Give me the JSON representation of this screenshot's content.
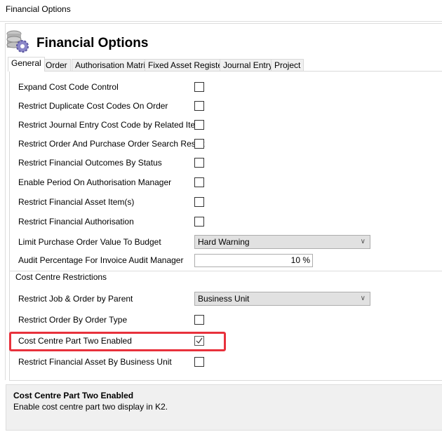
{
  "window": {
    "title": "Financial Options"
  },
  "header": {
    "title": "Financial Options",
    "icon": "coins-gear-icon"
  },
  "tabs": [
    {
      "label": "General",
      "active": true
    },
    {
      "label": "Order"
    },
    {
      "label": "Authorisation Matrix"
    },
    {
      "label": "Fixed Asset Register"
    },
    {
      "label": "Journal Entry"
    },
    {
      "label": "Project"
    }
  ],
  "general": {
    "options": [
      {
        "label": "Expand Cost Code Control",
        "checked": false
      },
      {
        "label": "Restrict Duplicate Cost Codes On Order",
        "checked": false
      },
      {
        "label": "Restrict Journal Entry Cost Code by Related Item",
        "checked": false
      },
      {
        "label": "Restrict Order And Purchase Order Search Result",
        "checked": false
      },
      {
        "label": "Restrict Financial Outcomes By Status",
        "checked": false
      },
      {
        "label": "Enable Period On Authorisation Manager",
        "checked": false
      },
      {
        "label": "Restrict Financial Asset Item(s)",
        "checked": false
      },
      {
        "label": "Restrict Financial Authorisation",
        "checked": false
      }
    ],
    "limit_po": {
      "label": "Limit Purchase Order Value To Budget",
      "value": "Hard Warning"
    },
    "audit_pct": {
      "label": "Audit Percentage For Invoice Audit Manager",
      "value": "10 %"
    }
  },
  "cost_centre": {
    "group_label": "Cost Centre Restrictions",
    "restrict_job": {
      "label": "Restrict Job & Order by Parent",
      "value": "Business Unit"
    },
    "options": [
      {
        "label": "Restrict Order By Order Type",
        "checked": false
      },
      {
        "label": "Cost Centre Part Two Enabled",
        "checked": true,
        "highlighted": true
      },
      {
        "label": "Restrict Financial Asset By Business Unit",
        "checked": false
      }
    ]
  },
  "help": {
    "title": "Cost Centre Part Two Enabled",
    "description": "Enable cost centre part two display in K2."
  },
  "colors": {
    "highlight": "#e8313c"
  }
}
